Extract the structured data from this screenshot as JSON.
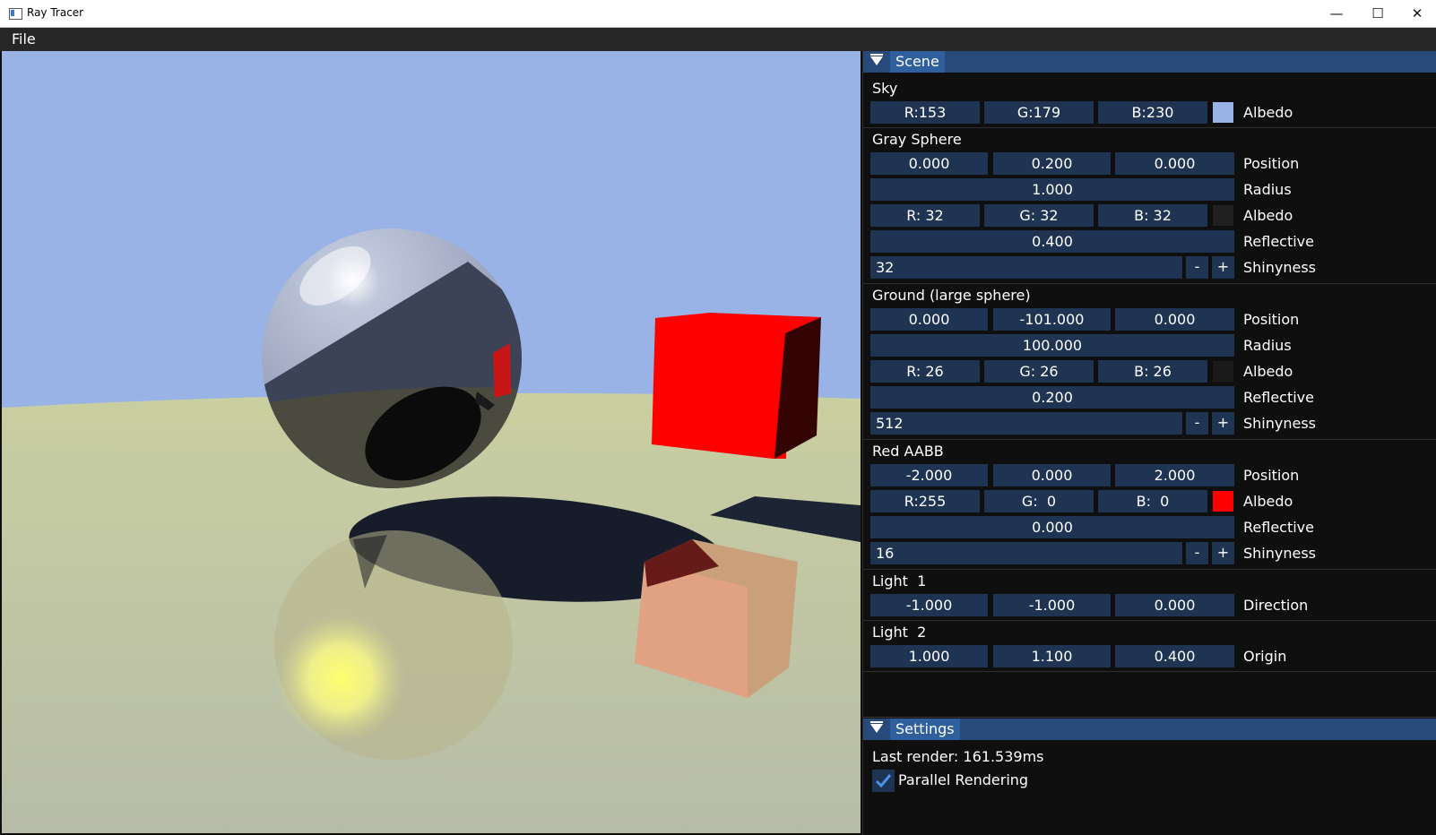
{
  "window": {
    "title": "Ray Tracer",
    "minimize": "—",
    "maximize": "☐",
    "close": "✕"
  },
  "menu": {
    "file": "File"
  },
  "scene": {
    "header": "Scene",
    "sky": {
      "title": "Sky",
      "r": "R:153",
      "g": "G:179",
      "b": "B:230",
      "albedo_color": "#99b3e6",
      "albedo_label": "Albedo"
    },
    "gray_sphere": {
      "title": "Gray Sphere",
      "position": [
        "0.000",
        "0.200",
        "0.000"
      ],
      "position_label": "Position",
      "radius": "1.000",
      "radius_label": "Radius",
      "r": "R: 32",
      "g": "G: 32",
      "b": "B: 32",
      "albedo_color": "#202020",
      "albedo_label": "Albedo",
      "reflective": "0.400",
      "reflective_label": "Reflective",
      "shinyness": "32",
      "shinyness_label": "Shinyness",
      "minus": "-",
      "plus": "+"
    },
    "ground": {
      "title": "Ground (large sphere)",
      "position": [
        "0.000",
        "-101.000",
        "0.000"
      ],
      "position_label": "Position",
      "radius": "100.000",
      "radius_label": "Radius",
      "r": "R: 26",
      "g": "G: 26",
      "b": "B: 26",
      "albedo_color": "#1a1a1a",
      "albedo_label": "Albedo",
      "reflective": "0.200",
      "reflective_label": "Reflective",
      "shinyness": "512",
      "shinyness_label": "Shinyness",
      "minus": "-",
      "plus": "+"
    },
    "red_aabb": {
      "title": "Red AABB",
      "position": [
        "-2.000",
        "0.000",
        "2.000"
      ],
      "position_label": "Position",
      "r": "R:255",
      "g": "G:  0",
      "b": "B:  0",
      "albedo_color": "#ff0000",
      "albedo_label": "Albedo",
      "reflective": "0.000",
      "reflective_label": "Reflective",
      "shinyness": "16",
      "shinyness_label": "Shinyness",
      "minus": "-",
      "plus": "+"
    },
    "light1": {
      "title": "Light  1",
      "direction": [
        "-1.000",
        "-1.000",
        "0.000"
      ],
      "direction_label": "Direction"
    },
    "light2": {
      "title": "Light  2",
      "origin": [
        "1.000",
        "1.100",
        "0.400"
      ],
      "origin_label": "Origin"
    }
  },
  "settings": {
    "header": "Settings",
    "last_render": "Last render: 161.539ms",
    "parallel_rendering": "Parallel Rendering",
    "parallel_checked": true
  },
  "colors": {
    "accent": "#2f5f9c",
    "field": "#1e3452",
    "sky": "#99b3e6",
    "cube": "#ff0000"
  }
}
